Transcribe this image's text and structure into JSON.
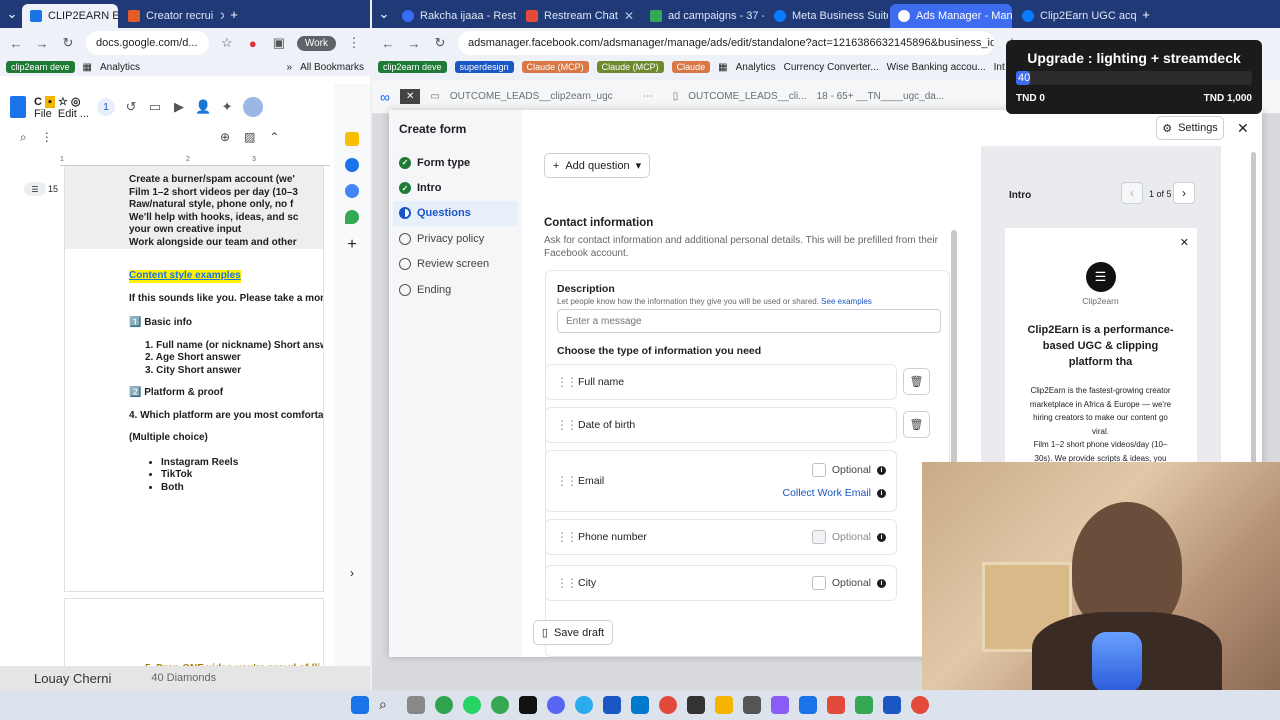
{
  "docs_window": {
    "tabs": [
      {
        "label": "CLIP2EARN E"
      },
      {
        "label": "Creator recrui"
      }
    ],
    "url": "docs.google.com/d...",
    "profile": "Work",
    "bookmarks": [
      "clip2earn deve",
      "Analytics",
      "All Bookmarks"
    ],
    "menu": {
      "file": "File",
      "edit": "Edit ..."
    },
    "outline_count": "15",
    "ruler_ticks": [
      "1",
      "1",
      "2",
      "3"
    ],
    "doc_lines": {
      "b1": "Create a burner/spam account (we'",
      "b2": "Film 1–2 short videos per day (10–3",
      "b3": "Raw/natural style,  phone only, no f",
      "b4": "We'll help with hooks, ideas, and sc",
      "b4b": "your own creative input",
      "b5": "Work alongside our team and other",
      "content_style": "Content style examples",
      "intro": "If this sounds like you. Please take a mom",
      "basic": "1️⃣ Basic info",
      "q1": "1.   Full name (or nickname) Short answ",
      "q2": "2.   Age Short answer",
      "q3": "3.   City Short answer",
      "platform": "2️⃣ Platform & proof",
      "q4": "4. Which platform are you most comfortab",
      "multi": "(Multiple choice)",
      "o1": "Instagram Reels",
      "o2": "TikTok",
      "o3": "Both",
      "q5": "5.   Drop ONE video you're proud of (li"
    },
    "overlay_name": "Louay Cherni",
    "overlay_diamonds": "40 Diamonds"
  },
  "ads_window": {
    "tabs": [
      {
        "label": "Rakcha ijaaa - Restre"
      },
      {
        "label": "Restream Chat"
      },
      {
        "label": "ad campaigns - 37 -"
      },
      {
        "label": "Meta Business Suite"
      },
      {
        "label": "Ads Manager - Mana"
      },
      {
        "label": "Clip2Earn UGC acqu"
      }
    ],
    "url": "adsmanager.facebook.com/adsmanager/manage/ads/edit/standalone?act=1216386632145896&business_id=592957164...",
    "bookmarks": [
      "clip2earn deve",
      "superdesign",
      "Claude (MCP)",
      "Claude (MCP)",
      "Claude",
      "Analytics",
      "Currency Converter...",
      "Wise Banking accou...",
      "Int"
    ],
    "toolbar": {
      "campaign": "OUTCOME_LEADS__clip2earn_ugc",
      "adset": "OUTCOME_LEADS__cli...",
      "ad": "18 - 65+ __TN____ugc_da..."
    },
    "form": {
      "title": "Create form",
      "steps": [
        "Form type",
        "Intro",
        "Questions",
        "Privacy policy",
        "Review screen",
        "Ending"
      ],
      "add_question": "Add question",
      "contact_title": "Contact information",
      "contact_desc": "Ask for contact information and additional personal details. This will be prefilled from their Facebook account.",
      "desc_label": "Description",
      "desc_help": "Let people know how the information they give you will be used or shared.",
      "see_examples": "See examples",
      "desc_placeholder": "Enter a message",
      "choose_type": "Choose the type of information you need",
      "fields": [
        "Full name",
        "Date of birth",
        "Email",
        "Phone number",
        "City"
      ],
      "optional": "Optional",
      "collect_work_email": "Collect Work Email",
      "save_draft": "Save draft",
      "settings": "Settings"
    },
    "preview": {
      "section": "Intro",
      "pager": "1 of 5",
      "brand": "Clip2earn",
      "headline": "Clip2Earn is a performance-based UGC & clipping platform tha",
      "body1": "Clip2Earn is the fastest-growing creator marketplace in Africa & Europe — we're hiring creators to make our content go viral.",
      "body2": "Film 1–2 short phone videos/day (10–30s). We provide scripts & ideas, you"
    }
  },
  "overlay_goal": {
    "title": "Upgrade : lighting + streamdeck",
    "value": "40",
    "min": "TND 0",
    "max": "TND 1,000",
    "progress": 0.04
  },
  "colors": {
    "accent": "#1a56c4",
    "success": "#1e7a34",
    "tabbar": "#1f3a77"
  }
}
